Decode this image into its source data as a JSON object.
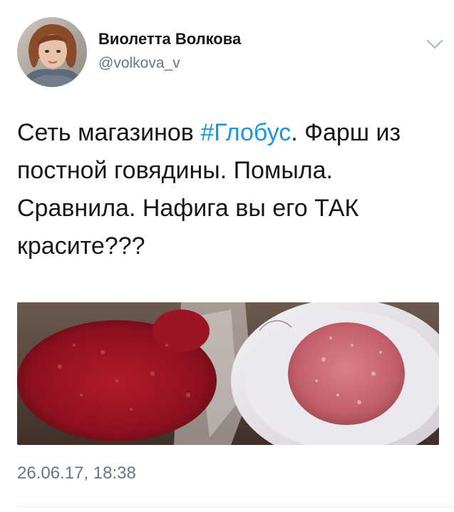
{
  "user": {
    "display_name": "Виолетта Волкова",
    "handle": "@volkova_v"
  },
  "tweet": {
    "text_before": "Сеть магазинов ",
    "hashtag": "#Глобус",
    "text_after": ". Фарш из постной говядины. Помыла. Сравнила. Нафига вы его ТАК красите???",
    "timestamp": "26.06.17, 18:38"
  },
  "colors": {
    "hashtag": "#1b95e0",
    "secondary_text": "#657786",
    "primary_text": "#14171a"
  },
  "icons": {
    "menu": "chevron-down-icon"
  }
}
